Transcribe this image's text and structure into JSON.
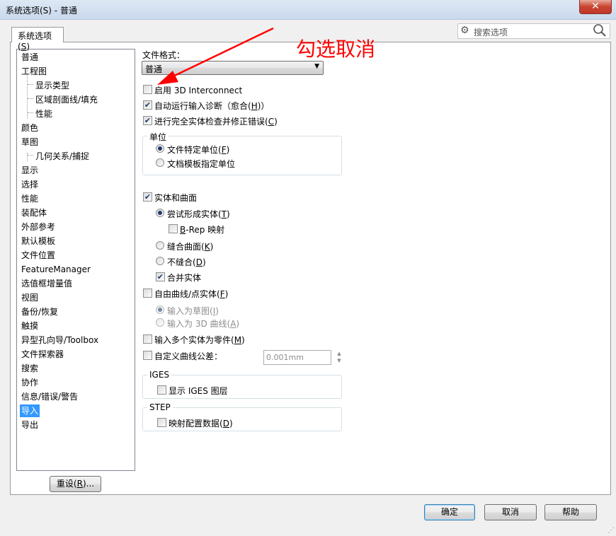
{
  "window": {
    "title": "系统选项(S) - 普通",
    "close": "✕"
  },
  "tab": {
    "label_pre": "系统选项(",
    "label_key": "S",
    "label_post": ")"
  },
  "search": {
    "placeholder": "搜索选项"
  },
  "tree": [
    {
      "label": "普通",
      "indent": 0
    },
    {
      "label": "工程图",
      "indent": 0
    },
    {
      "label": "显示类型",
      "indent": 1
    },
    {
      "label": "区域剖面线/填充",
      "indent": 1
    },
    {
      "label": "性能",
      "indent": 1
    },
    {
      "label": "颜色",
      "indent": 0
    },
    {
      "label": "草图",
      "indent": 0
    },
    {
      "label": "几何关系/捕捉",
      "indent": 1
    },
    {
      "label": "显示",
      "indent": 0
    },
    {
      "label": "选择",
      "indent": 0
    },
    {
      "label": "性能",
      "indent": 0
    },
    {
      "label": "装配体",
      "indent": 0
    },
    {
      "label": "外部参考",
      "indent": 0
    },
    {
      "label": "默认模板",
      "indent": 0
    },
    {
      "label": "文件位置",
      "indent": 0
    },
    {
      "label": "FeatureManager",
      "indent": 0
    },
    {
      "label": "选值框增量值",
      "indent": 0
    },
    {
      "label": "视图",
      "indent": 0
    },
    {
      "label": "备份/恢复",
      "indent": 0
    },
    {
      "label": "触摸",
      "indent": 0
    },
    {
      "label": "异型孔向导/Toolbox",
      "indent": 0
    },
    {
      "label": "文件探索器",
      "indent": 0
    },
    {
      "label": "搜索",
      "indent": 0
    },
    {
      "label": "协作",
      "indent": 0
    },
    {
      "label": "信息/错误/警告",
      "indent": 0
    },
    {
      "label": "导入",
      "indent": 0,
      "selected": true
    },
    {
      "label": "导出",
      "indent": 0
    }
  ],
  "reset": {
    "pre": "重设(",
    "key": "R",
    "post": ")..."
  },
  "form": {
    "file_format_label": "文件格式：",
    "file_format_value": "普通",
    "enable_3d": {
      "label": "启用 3D Interconnect",
      "checked": false
    },
    "auto_diag": {
      "pre": "自动运行输入诊断（愈合(",
      "key": "H",
      "post": ")）",
      "checked": true
    },
    "full_check": {
      "pre": "进行完全实体检查并修正错误(",
      "key": "C",
      "post": ")",
      "checked": true
    },
    "units_group": "单位",
    "unit_file": {
      "pre": "文件特定单位(",
      "key": "F",
      "post": ")",
      "checked": true
    },
    "unit_template": {
      "label": "文档模板指定单位",
      "checked": false
    },
    "solid_surface": {
      "label": "实体和曲面",
      "checked": true
    },
    "try_solid": {
      "pre": "尝试形成实体(",
      "key": "T",
      "post": ")",
      "checked": true
    },
    "brep": {
      "key": "B",
      "rest": "-Rep 映射",
      "checked": false
    },
    "knit": {
      "pre": "缝合曲面(",
      "key": "K",
      "post": ")",
      "checked": false
    },
    "no_knit": {
      "pre": "不缝合(",
      "key": "D",
      "post": ")",
      "checked": false
    },
    "merge": {
      "label": "合并实体",
      "checked": true
    },
    "free_curve": {
      "pre": "自由曲线/点实体(",
      "key": "F",
      "post": ")",
      "checked": false
    },
    "as_sketch": {
      "pre": "输入为草图(",
      "key": "I",
      "post": ")"
    },
    "as_3d": {
      "pre": "输入为 3D 曲线(",
      "key": "A",
      "post": ")"
    },
    "multi_body": {
      "pre": "输入多个实体为零件(",
      "key": "M",
      "post": ")",
      "checked": false
    },
    "custom_tol": {
      "label": "自定义曲线公差：",
      "checked": false,
      "value": "0.001mm"
    },
    "iges_group": "IGES",
    "iges_layer": {
      "label": "显示 IGES 图层",
      "checked": false
    },
    "step_group": "STEP",
    "step_map": {
      "pre": "映射配置数据(",
      "key": "D",
      "post": ")",
      "checked": false
    }
  },
  "buttons": {
    "ok": "确定",
    "cancel": "取消",
    "help": "帮助"
  },
  "annotation": {
    "text": "勾选取消",
    "color": "#ff0000"
  },
  "icons": {
    "gear": "gear-icon",
    "search": "magnifier-icon",
    "close": "close-icon"
  }
}
